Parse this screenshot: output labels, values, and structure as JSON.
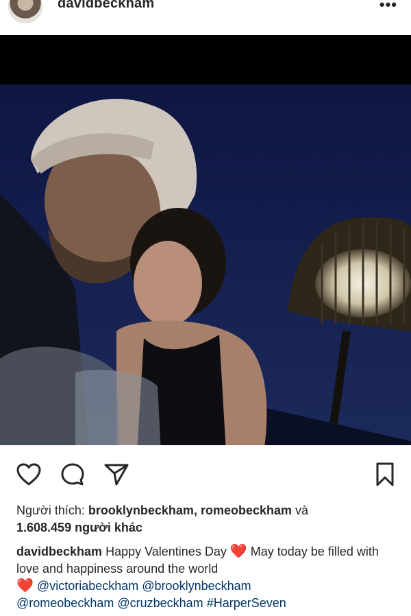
{
  "header": {
    "username": "davidbeckham",
    "more_icon": "ellipsis-icon"
  },
  "actions": {
    "like_icon": "heart-outline-icon",
    "comment_icon": "comment-icon",
    "share_icon": "paper-plane-icon",
    "save_icon": "bookmark-icon"
  },
  "likes": {
    "prefix": "Người thích: ",
    "user1": "brooklynbeckham",
    "sep": ", ",
    "user2": "romeobeckham",
    "and": " và",
    "count": "1.608.459 người khác"
  },
  "caption": {
    "username": "davidbeckham",
    "text1": " Happy Valentines Day ",
    "heart1": "❤️",
    "text2": " May today be filled with love and happiness around the world",
    "heart2": "❤️",
    "mention1": "@victoriabeckham",
    "mention2": "@brooklynbeckham",
    "mention3": "@romeobeckham",
    "mention4": "@cruzbeckham",
    "hashtag": "#HarperSeven"
  },
  "colors": {
    "text": "#262626",
    "link": "#003569",
    "heart": "#e0245e",
    "photo_sky": "#141c4a"
  }
}
